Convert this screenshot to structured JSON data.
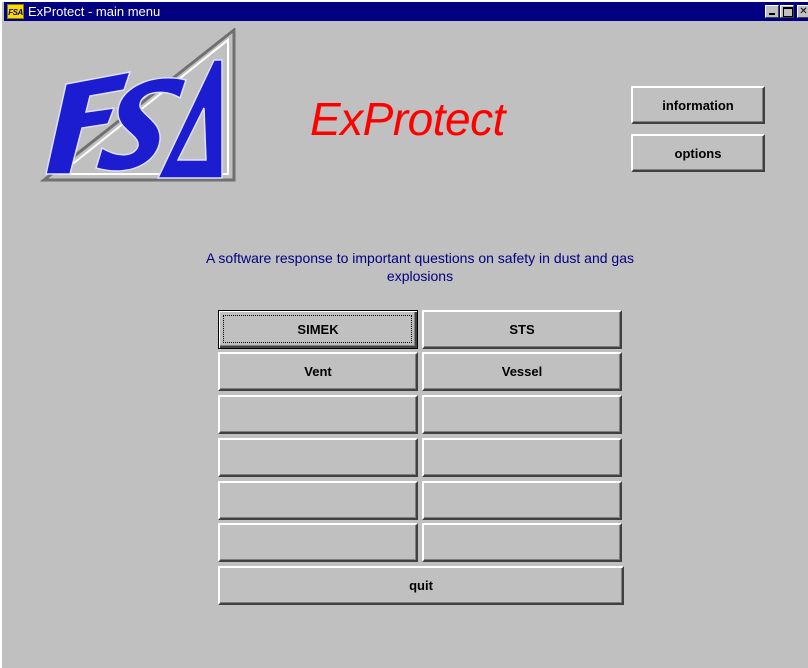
{
  "window": {
    "title": "ExProtect - main menu",
    "icon_text": "FSA",
    "controls": {
      "minimize": "",
      "maximize": "",
      "close": "✕"
    }
  },
  "logo": {
    "text": "FSA"
  },
  "app_title": "ExProtect",
  "side_buttons": {
    "information": "information",
    "options": "options"
  },
  "tagline": "A software response to important questions on safety in dust and gas explosions",
  "modules": {
    "simek": "SIMEK",
    "sts": "STS",
    "vent": "Vent",
    "vessel": "Vessel",
    "empty": ""
  },
  "quit_label": "quit",
  "colors": {
    "titlebar": "#000080",
    "app_title": "#ff0000",
    "tagline": "#000080",
    "logo_blue": "#1c1cd0",
    "face": "#c0c0c0"
  }
}
